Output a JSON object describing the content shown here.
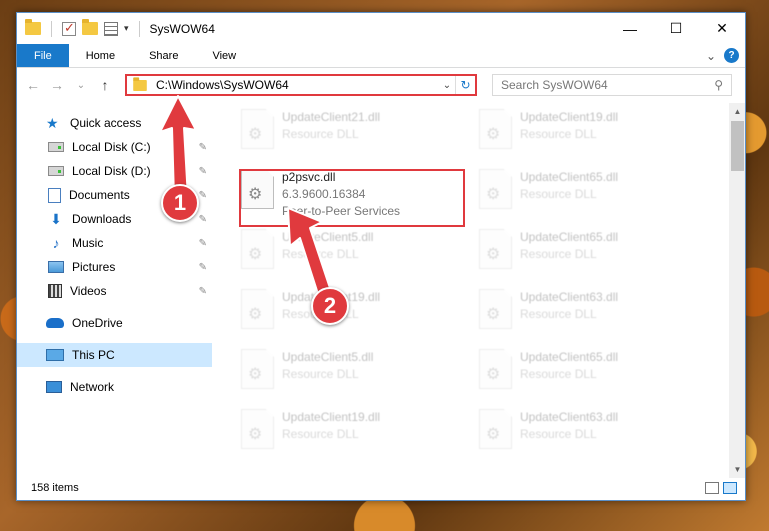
{
  "window": {
    "title": "SysWOW64",
    "controls": {
      "minimize": "—",
      "maximize": "☐",
      "close": "✕"
    }
  },
  "ribbon": {
    "tabs": [
      "File",
      "Home",
      "Share",
      "View"
    ],
    "expand_chevron": "⌄",
    "help": "?"
  },
  "address": {
    "back": "←",
    "forward": "→",
    "recent": "⌄",
    "up": "↑",
    "path": "C:\\Windows\\SysWOW64",
    "dropdown": "⌄",
    "refresh": "↻",
    "search_placeholder": "Search SysWOW64",
    "search_icon": "⚲"
  },
  "nav": {
    "items": [
      {
        "label": "Quick access",
        "icon": "star-icon",
        "glyph": "★"
      },
      {
        "label": "Local Disk (C:)",
        "icon": "drive-icon",
        "pinned": true
      },
      {
        "label": "Local Disk (D:)",
        "icon": "drive-icon",
        "pinned": true
      },
      {
        "label": "Documents",
        "icon": "documents-icon",
        "pinned": true
      },
      {
        "label": "Downloads",
        "icon": "download-icon",
        "glyph": "⬇",
        "pinned": true
      },
      {
        "label": "Music",
        "icon": "music-icon",
        "glyph": "♪",
        "pinned": true
      },
      {
        "label": "Pictures",
        "icon": "pictures-icon",
        "pinned": true
      },
      {
        "label": "Videos",
        "icon": "videos-icon",
        "pinned": true
      },
      {
        "label": "OneDrive",
        "icon": "cloud-icon"
      },
      {
        "label": "This PC",
        "icon": "computer-icon",
        "selected": true
      },
      {
        "label": "Network",
        "icon": "network-icon"
      }
    ],
    "pin_glyph": "📌"
  },
  "files": {
    "highlighted": {
      "name": "p2psvc.dll",
      "version": "6.3.9600.16384",
      "description": "Peer-to-Peer Services"
    },
    "left_column": [
      {
        "name": "UpdateClient21.dll",
        "type": "Resource DLL"
      },
      {
        "name": "UpdateClient5.dll",
        "type": "Resource DLL"
      },
      {
        "name": "UpdateClient19.dll",
        "type": "Resource DLL"
      },
      {
        "name": "UpdateClient5.dll",
        "type": "Resource DLL"
      },
      {
        "name": "UpdateClient19.dll",
        "type": "Resource DLL"
      }
    ],
    "right_column": [
      {
        "name": "UpdateClient19.dll",
        "type": "Resource DLL"
      },
      {
        "name": "UpdateClient65.dll",
        "type": "Resource DLL"
      },
      {
        "name": "UpdateClient65.dll",
        "type": "Resource DLL"
      },
      {
        "name": "UpdateClient63.dll",
        "type": "Resource DLL"
      },
      {
        "name": "UpdateClient65.dll",
        "type": "Resource DLL"
      },
      {
        "name": "UpdateClient63.dll",
        "type": "Resource DLL"
      }
    ]
  },
  "status": {
    "item_count": "158 items"
  },
  "annotations": {
    "step1": "1",
    "step2": "2",
    "color": "#e03a3e"
  },
  "scroll": {
    "up": "▲",
    "down": "▼"
  }
}
